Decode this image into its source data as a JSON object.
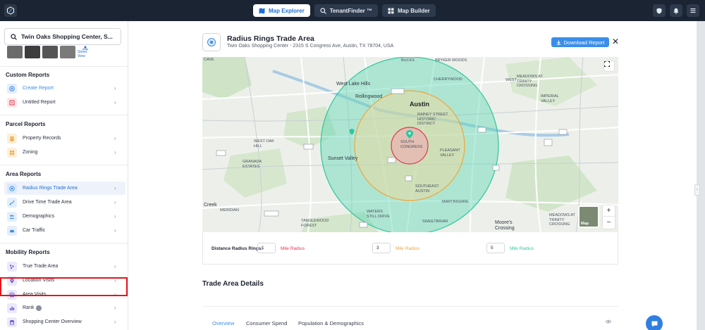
{
  "nav": {
    "tabs": [
      {
        "label": "Map Explorer",
        "icon": "map-icon",
        "active": true
      },
      {
        "label": "TenantFinder ™",
        "icon": "search-icon",
        "active": false
      },
      {
        "label": "Map Builder",
        "icon": "grid-icon",
        "active": false
      }
    ],
    "right_icons": [
      "shield-icon",
      "bell-icon",
      "menu-icon"
    ]
  },
  "sidebar": {
    "search_value": "Twin Oaks Shopping Center, S...",
    "street_view_label": "Street View",
    "sections": [
      {
        "title": "Custom Reports",
        "items": [
          {
            "label": "Create Report",
            "icon": "plus-circle-icon",
            "color": "#3b8ee8",
            "active_text": true
          },
          {
            "label": "Untitled Report",
            "icon": "flag-icon",
            "color": "#e2354c"
          }
        ]
      },
      {
        "title": "Parcel Reports",
        "items": [
          {
            "label": "Property Records",
            "icon": "building-icon",
            "color": "#e9a23b"
          },
          {
            "label": "Zoning",
            "icon": "zoning-icon",
            "color": "#e9a23b"
          }
        ]
      },
      {
        "title": "Area Reports",
        "items": [
          {
            "label": "Radius Rings Trade Area",
            "icon": "radius-icon",
            "color": "#3b8ee8",
            "active": true
          },
          {
            "label": "Drive Time Trade Area",
            "icon": "car-route-icon",
            "color": "#3b8ee8"
          },
          {
            "label": "Demographics",
            "icon": "people-icon",
            "color": "#3b8ee8"
          },
          {
            "label": "Car Traffic",
            "icon": "car-icon",
            "color": "#3b8ee8"
          }
        ]
      },
      {
        "title": "Mobility Reports",
        "items": [
          {
            "label": "True Trade Area",
            "icon": "dots-icon",
            "color": "#6a5bd6"
          },
          {
            "label": "Location Visits",
            "icon": "pin-icon",
            "color": "#6a5bd6"
          },
          {
            "label": "Area Visits",
            "icon": "area-icon",
            "color": "#6a5bd6"
          },
          {
            "label": "Rank",
            "icon": "bar-chart-icon",
            "color": "#6a5bd6",
            "badge": true
          },
          {
            "label": "Shopping Center Overview",
            "icon": "store-icon",
            "color": "#6a5bd6"
          }
        ]
      }
    ]
  },
  "report": {
    "title": "Radius Rings Trade Area",
    "subtitle": "Twin Oaks Shopping Center - 2315 S Congress Ave, Austin, TX 78704, USA",
    "download_label": "Download Report",
    "trade_area_title": "Trade Area Details"
  },
  "map": {
    "labels": [
      {
        "text": "Cave",
        "cls": ""
      },
      {
        "text": "BUCKS",
        "cls": ""
      },
      {
        "text": "BRYKER WOODS",
        "cls": ""
      },
      {
        "text": "WEST",
        "cls": ""
      },
      {
        "text": "West Lake Hills",
        "cls": "mid"
      },
      {
        "text": "CHERRYWOOD",
        "cls": ""
      },
      {
        "text": "Rollingwood",
        "cls": "mid"
      },
      {
        "text": "Austin",
        "cls": "big"
      },
      {
        "text": "RAINEY STREET HISTORIC DISTRICT",
        "cls": ""
      },
      {
        "text": "SOUTH CONGRESS",
        "cls": ""
      },
      {
        "text": "PLEASANT VALLEY",
        "cls": ""
      },
      {
        "text": "WEST OAK HILL",
        "cls": ""
      },
      {
        "text": "GRANADA ESTATES",
        "cls": ""
      },
      {
        "text": "Sunset Valley",
        "cls": "mid"
      },
      {
        "text": "SOUTHEAST AUSTIN",
        "cls": ""
      },
      {
        "text": "MARTINSHIRE",
        "cls": ""
      },
      {
        "text": "Creek",
        "cls": "mid"
      },
      {
        "text": "MERIDIAN",
        "cls": ""
      },
      {
        "text": "TANGLEWOOD FOREST",
        "cls": ""
      },
      {
        "text": "SWEETBRIAR",
        "cls": ""
      },
      {
        "text": "MEADOWS AT TRINITY CROSSING",
        "cls": ""
      },
      {
        "text": "IMPERIAL VALLEY",
        "cls": ""
      },
      {
        "text": "MEADOWS AT TRINITY CROSSING",
        "cls": ""
      },
      {
        "text": "Moore's Crossing",
        "cls": "mid"
      },
      {
        "text": "WATERS STILL DRIVE",
        "cls": ""
      }
    ],
    "map_type_label": "Map",
    "zoom_in": "+",
    "zoom_out": "−"
  },
  "radius": {
    "label": "Distance Radius Rings:",
    "rings": [
      {
        "value": "1",
        "unit": "Mile Radius",
        "color": "#e2354c"
      },
      {
        "value": "3",
        "unit": "Mile Radius",
        "color": "#f0a63a"
      },
      {
        "value": "5",
        "unit": "Mile Radius",
        "color": "#2ec6a0"
      }
    ]
  },
  "tabs": [
    {
      "label": "Overview",
      "active": true
    },
    {
      "label": "Consumer Spend",
      "active": false
    },
    {
      "label": "Population & Demographics",
      "active": false
    }
  ]
}
